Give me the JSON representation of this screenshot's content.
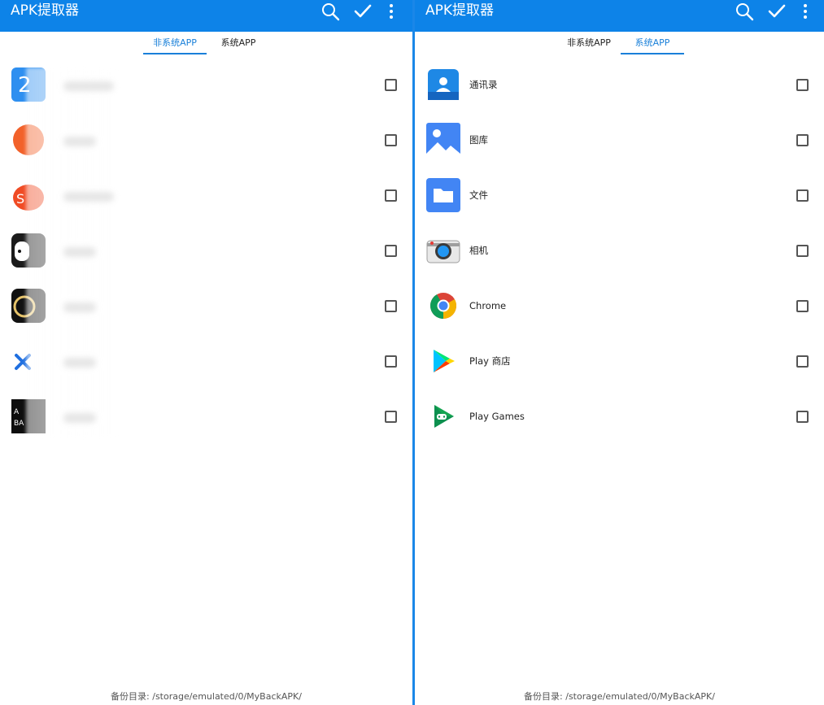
{
  "left": {
    "title": "APK提取器",
    "tabs": [
      {
        "label": "非系统APP",
        "active": true
      },
      {
        "label": "系统APP",
        "active": false
      }
    ],
    "apps_count": 7,
    "footer": "备份目录: /storage/emulated/0/MyBackAPK/"
  },
  "right": {
    "title": "APK提取器",
    "tabs": [
      {
        "label": "非系统APP",
        "active": false
      },
      {
        "label": "系统APP",
        "active": true
      }
    ],
    "apps": [
      {
        "name": "通讯录",
        "icon": "contacts-icon"
      },
      {
        "name": "图库",
        "icon": "gallery-icon"
      },
      {
        "name": "文件",
        "icon": "files-icon"
      },
      {
        "name": "相机",
        "icon": "camera-icon"
      },
      {
        "name": "Chrome",
        "icon": "chrome-icon"
      },
      {
        "name": "Play 商店",
        "icon": "play-store-icon"
      },
      {
        "name": "Play Games",
        "icon": "play-games-icon"
      }
    ],
    "footer": "备份目录: /storage/emulated/0/MyBackAPK/"
  },
  "colors": {
    "appbar": "#0d83e8",
    "accent": "#1a80d9"
  }
}
